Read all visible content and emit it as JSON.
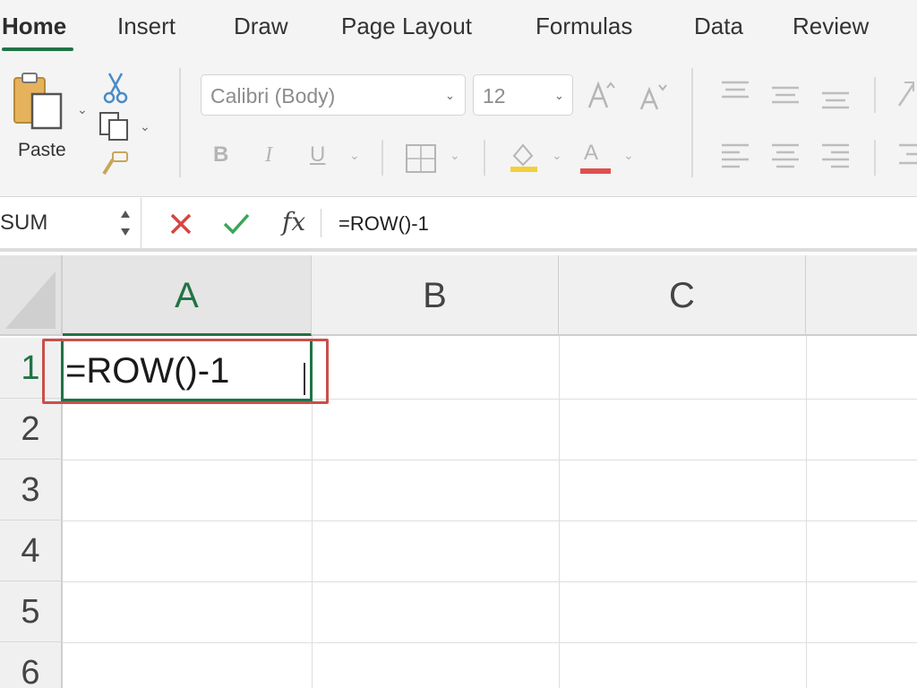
{
  "ribbon_tabs": [
    "Home",
    "Insert",
    "Draw",
    "Page Layout",
    "Formulas",
    "Data",
    "Review"
  ],
  "active_tab": "Home",
  "clipboard": {
    "paste_label": "Paste"
  },
  "font": {
    "name": "Calibri (Body)",
    "size": "12"
  },
  "format_buttons": {
    "bold": "B",
    "italic": "I",
    "underline": "U",
    "font_color": "A"
  },
  "formula_bar": {
    "name_box": "SUM",
    "formula": "=ROW()-1",
    "fx_label": "fx"
  },
  "grid": {
    "columns": [
      "A",
      "B",
      "C"
    ],
    "rows": [
      "1",
      "2",
      "3",
      "4",
      "5",
      "6"
    ],
    "active_cell_text": "=ROW()-1"
  },
  "colors": {
    "accent": "#217346",
    "cancel": "#d64541",
    "enter": "#3aa757",
    "highlight": "#c9504a",
    "fill": "#f2d03b",
    "font_color_bar": "#e04f4f"
  }
}
